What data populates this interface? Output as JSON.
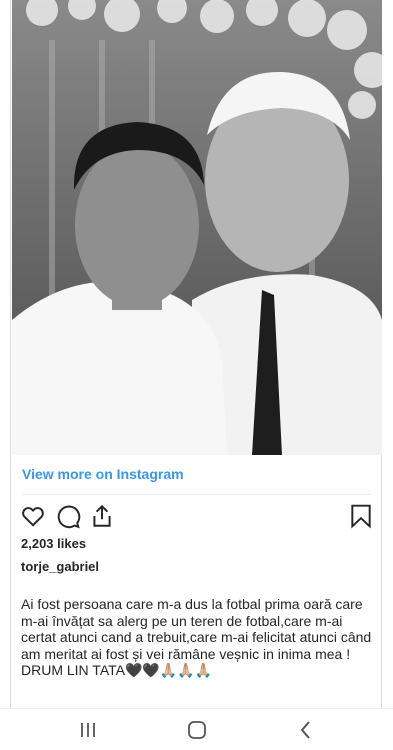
{
  "post": {
    "image_alt": "Black and white selfie of a young man and an older man in white shirts with flowers above",
    "view_more_label": "View more on Instagram",
    "likes": "2,203 likes",
    "username": "torje_gabriel",
    "caption": "Ai fost persoana care m-a dus la fotbal prima oară care m-ai învățat sa alerg pe un teren de fotbal,care m-ai certat atunci cand a trebuit,care m-ai felicitat atunci când am meritat ai fost și vei rămâne veșnic in inima mea !\nDRUM LIN TATA🖤🖤🙏🏼🙏🏼🙏🏼"
  },
  "actions": {
    "like_icon": "heart-icon",
    "comment_icon": "comment-icon",
    "share_icon": "share-icon",
    "save_icon": "bookmark-icon"
  },
  "navbar": {
    "recents_icon": "recents-icon",
    "home_icon": "home-icon",
    "back_icon": "back-icon"
  }
}
